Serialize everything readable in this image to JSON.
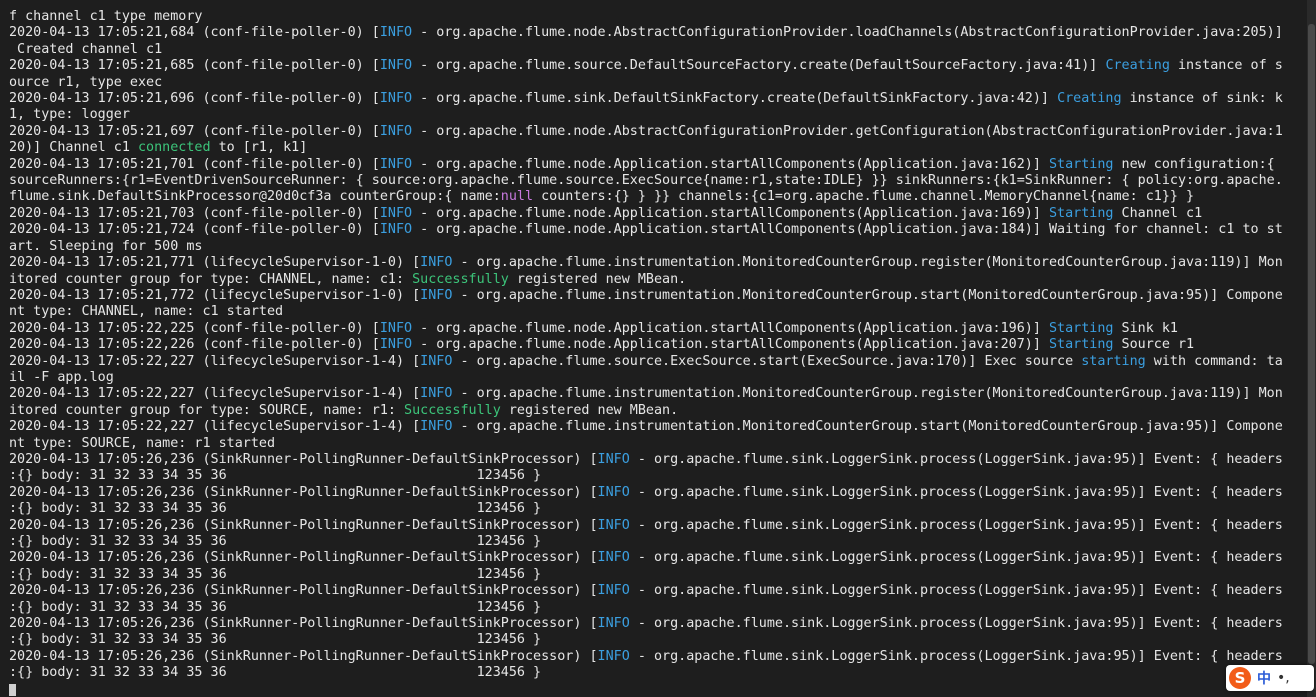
{
  "terminal": {
    "lines": [
      [
        {
          "t": "f channel c1 type memory"
        }
      ],
      [
        {
          "t": "2020-04-13 17:05:21,684 (conf-file-poller-0) ["
        },
        {
          "t": "INFO",
          "c": "info"
        },
        {
          "t": " - org.apache.flume.node.AbstractConfigurationProvider.loadChannels(AbstractConfigurationProvider.java:205)]"
        }
      ],
      [
        {
          "t": " Created channel c1"
        }
      ],
      [
        {
          "t": "2020-04-13 17:05:21,685 (conf-file-poller-0) ["
        },
        {
          "t": "INFO",
          "c": "info"
        },
        {
          "t": " - org.apache.flume.source.DefaultSourceFactory.create(DefaultSourceFactory.java:41)] "
        },
        {
          "t": "Creating",
          "c": "blue"
        },
        {
          "t": " instance of s"
        }
      ],
      [
        {
          "t": "ource r1, type exec"
        }
      ],
      [
        {
          "t": "2020-04-13 17:05:21,696 (conf-file-poller-0) ["
        },
        {
          "t": "INFO",
          "c": "info"
        },
        {
          "t": " - org.apache.flume.sink.DefaultSinkFactory.create(DefaultSinkFactory.java:42)] "
        },
        {
          "t": "Creating",
          "c": "blue"
        },
        {
          "t": " instance of sink: k"
        }
      ],
      [
        {
          "t": "1, type: logger"
        }
      ],
      [
        {
          "t": "2020-04-13 17:05:21,697 (conf-file-poller-0) ["
        },
        {
          "t": "INFO",
          "c": "info"
        },
        {
          "t": " - org.apache.flume.node.AbstractConfigurationProvider.getConfiguration(AbstractConfigurationProvider.java:1"
        }
      ],
      [
        {
          "t": "20)] Channel c1 "
        },
        {
          "t": "connected",
          "c": "green"
        },
        {
          "t": " to [r1, k1]"
        }
      ],
      [
        {
          "t": "2020-04-13 17:05:21,701 (conf-file-poller-0) ["
        },
        {
          "t": "INFO",
          "c": "info"
        },
        {
          "t": " - org.apache.flume.node.Application.startAllComponents(Application.java:162)] "
        },
        {
          "t": "Starting",
          "c": "blue"
        },
        {
          "t": " new configuration:{"
        }
      ],
      [
        {
          "t": "sourceRunners:{r1=EventDrivenSourceRunner: { source:org.apache.flume.source.ExecSource{name:r1,state:IDLE} }} sinkRunners:{k1=SinkRunner: { policy:org.apache."
        }
      ],
      [
        {
          "t": "flume.sink.DefaultSinkProcessor@20d0cf3a counterGroup:{ name:"
        },
        {
          "t": "null",
          "c": "magenta"
        },
        {
          "t": " counters:{} } }} channels:{c1=org.apache.flume.channel.MemoryChannel{name: c1}} }"
        }
      ],
      [
        {
          "t": "2020-04-13 17:05:21,703 (conf-file-poller-0) ["
        },
        {
          "t": "INFO",
          "c": "info"
        },
        {
          "t": " - org.apache.flume.node.Application.startAllComponents(Application.java:169)] "
        },
        {
          "t": "Starting",
          "c": "blue"
        },
        {
          "t": " Channel c1"
        }
      ],
      [
        {
          "t": "2020-04-13 17:05:21,724 (conf-file-poller-0) ["
        },
        {
          "t": "INFO",
          "c": "info"
        },
        {
          "t": " - org.apache.flume.node.Application.startAllComponents(Application.java:184)] Waiting for channel: c1 to st"
        }
      ],
      [
        {
          "t": "art. Sleeping for 500 ms"
        }
      ],
      [
        {
          "t": "2020-04-13 17:05:21,771 (lifecycleSupervisor-1-0) ["
        },
        {
          "t": "INFO",
          "c": "info"
        },
        {
          "t": " - org.apache.flume.instrumentation.MonitoredCounterGroup.register(MonitoredCounterGroup.java:119)] Mon"
        }
      ],
      [
        {
          "t": "itored counter group for type: CHANNEL, name: c1: "
        },
        {
          "t": "Successfully",
          "c": "green"
        },
        {
          "t": " registered new MBean."
        }
      ],
      [
        {
          "t": "2020-04-13 17:05:21,772 (lifecycleSupervisor-1-0) ["
        },
        {
          "t": "INFO",
          "c": "info"
        },
        {
          "t": " - org.apache.flume.instrumentation.MonitoredCounterGroup.start(MonitoredCounterGroup.java:95)] Compone"
        }
      ],
      [
        {
          "t": "nt type: CHANNEL, name: c1 started"
        }
      ],
      [
        {
          "t": "2020-04-13 17:05:22,225 (conf-file-poller-0) ["
        },
        {
          "t": "INFO",
          "c": "info"
        },
        {
          "t": " - org.apache.flume.node.Application.startAllComponents(Application.java:196)] "
        },
        {
          "t": "Starting",
          "c": "blue"
        },
        {
          "t": " Sink k1"
        }
      ],
      [
        {
          "t": "2020-04-13 17:05:22,226 (conf-file-poller-0) ["
        },
        {
          "t": "INFO",
          "c": "info"
        },
        {
          "t": " - org.apache.flume.node.Application.startAllComponents(Application.java:207)] "
        },
        {
          "t": "Starting",
          "c": "blue"
        },
        {
          "t": " Source r1"
        }
      ],
      [
        {
          "t": "2020-04-13 17:05:22,227 (lifecycleSupervisor-1-4) ["
        },
        {
          "t": "INFO",
          "c": "info"
        },
        {
          "t": " - org.apache.flume.source.ExecSource.start(ExecSource.java:170)] Exec source "
        },
        {
          "t": "starting",
          "c": "blue"
        },
        {
          "t": " with command: ta"
        }
      ],
      [
        {
          "t": "il -F app.log"
        }
      ],
      [
        {
          "t": "2020-04-13 17:05:22,227 (lifecycleSupervisor-1-4) ["
        },
        {
          "t": "INFO",
          "c": "info"
        },
        {
          "t": " - org.apache.flume.instrumentation.MonitoredCounterGroup.register(MonitoredCounterGroup.java:119)] Mon"
        }
      ],
      [
        {
          "t": "itored counter group for type: SOURCE, name: r1: "
        },
        {
          "t": "Successfully",
          "c": "green"
        },
        {
          "t": " registered new MBean."
        }
      ],
      [
        {
          "t": "2020-04-13 17:05:22,227 (lifecycleSupervisor-1-4) ["
        },
        {
          "t": "INFO",
          "c": "info"
        },
        {
          "t": " - org.apache.flume.instrumentation.MonitoredCounterGroup.start(MonitoredCounterGroup.java:95)] Compone"
        }
      ],
      [
        {
          "t": "nt type: SOURCE, name: r1 started"
        }
      ],
      [
        {
          "t": "2020-04-13 17:05:26,236 (SinkRunner-PollingRunner-DefaultSinkProcessor) ["
        },
        {
          "t": "INFO",
          "c": "info"
        },
        {
          "t": " - org.apache.flume.sink.LoggerSink.process(LoggerSink.java:95)] Event: { headers"
        }
      ],
      [
        {
          "t": ":{} body: 31 32 33 34 35 36                               123456 }"
        }
      ],
      [
        {
          "t": "2020-04-13 17:05:26,236 (SinkRunner-PollingRunner-DefaultSinkProcessor) ["
        },
        {
          "t": "INFO",
          "c": "info"
        },
        {
          "t": " - org.apache.flume.sink.LoggerSink.process(LoggerSink.java:95)] Event: { headers"
        }
      ],
      [
        {
          "t": ":{} body: 31 32 33 34 35 36                               123456 }"
        }
      ],
      [
        {
          "t": "2020-04-13 17:05:26,236 (SinkRunner-PollingRunner-DefaultSinkProcessor) ["
        },
        {
          "t": "INFO",
          "c": "info"
        },
        {
          "t": " - org.apache.flume.sink.LoggerSink.process(LoggerSink.java:95)] Event: { headers"
        }
      ],
      [
        {
          "t": ":{} body: 31 32 33 34 35 36                               123456 }"
        }
      ],
      [
        {
          "t": "2020-04-13 17:05:26,236 (SinkRunner-PollingRunner-DefaultSinkProcessor) ["
        },
        {
          "t": "INFO",
          "c": "info"
        },
        {
          "t": " - org.apache.flume.sink.LoggerSink.process(LoggerSink.java:95)] Event: { headers"
        }
      ],
      [
        {
          "t": ":{} body: 31 32 33 34 35 36                               123456 }"
        }
      ],
      [
        {
          "t": "2020-04-13 17:05:26,236 (SinkRunner-PollingRunner-DefaultSinkProcessor) ["
        },
        {
          "t": "INFO",
          "c": "info"
        },
        {
          "t": " - org.apache.flume.sink.LoggerSink.process(LoggerSink.java:95)] Event: { headers"
        }
      ],
      [
        {
          "t": ":{} body: 31 32 33 34 35 36                               123456 }"
        }
      ],
      [
        {
          "t": "2020-04-13 17:05:26,236 (SinkRunner-PollingRunner-DefaultSinkProcessor) ["
        },
        {
          "t": "INFO",
          "c": "info"
        },
        {
          "t": " - org.apache.flume.sink.LoggerSink.process(LoggerSink.java:95)] Event: { headers"
        }
      ],
      [
        {
          "t": ":{} body: 31 32 33 34 35 36                               123456 }"
        }
      ],
      [
        {
          "t": "2020-04-13 17:05:26,236 (SinkRunner-PollingRunner-DefaultSinkProcessor) ["
        },
        {
          "t": "INFO",
          "c": "info"
        },
        {
          "t": " - org.apache.flume.sink.LoggerSink.process(LoggerSink.java:95)] Event: { headers"
        }
      ],
      [
        {
          "t": ":{} body: 31 32 33 34 35 36                               123456 }"
        }
      ]
    ]
  },
  "ime": {
    "logo": "S",
    "mode": "中",
    "punct": "•,",
    "icon": "sogou-ime-icon"
  },
  "colors": {
    "background": "#1e1e1e",
    "text": "#e6e6e6",
    "info": "#3b9fe0",
    "highlight_blue": "#3b9fe0",
    "highlight_green": "#3cc47a",
    "highlight_magenta": "#c678dd"
  }
}
